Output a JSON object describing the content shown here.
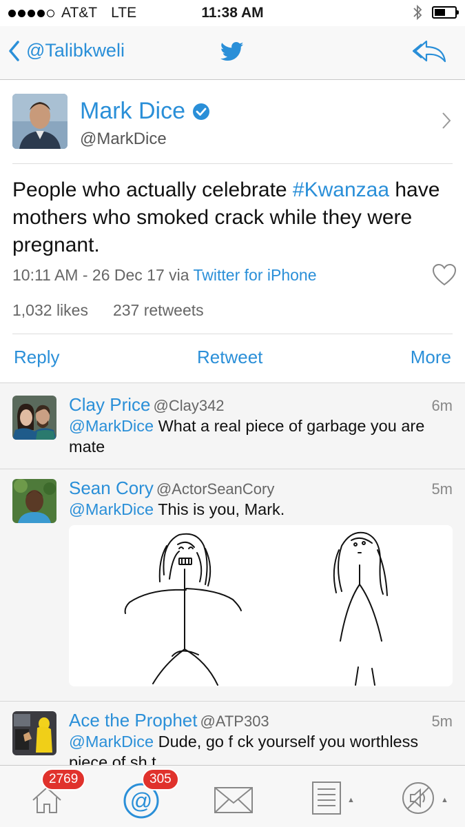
{
  "status_bar": {
    "carrier": "AT&T",
    "network": "LTE",
    "time": "11:38 AM",
    "signal_bars": 4,
    "battery_level": 0.55
  },
  "nav": {
    "back_label": "@Talibkweli",
    "center_icon": "twitter-bird-icon",
    "right_icon": "reply-all-icon"
  },
  "profile": {
    "name": "Mark Dice",
    "handle": "@MarkDice",
    "verified": true
  },
  "tweet": {
    "text_before": "People who actually celebrate ",
    "hashtag": "#Kwanzaa",
    "text_after": " have mothers who smoked crack while they were pregnant.",
    "timestamp": "10:11 AM - 26 Dec 17 via ",
    "client": "Twitter for iPhone",
    "likes": "1,032 likes",
    "retweets": "237 retweets"
  },
  "actions": {
    "reply": "Reply",
    "retweet": "Retweet",
    "more": "More"
  },
  "replies": [
    {
      "name": "Clay Price",
      "handle": "@Clay342",
      "time": "6m",
      "mention": "@MarkDice",
      "text": " What a real piece of garbage you are mate"
    },
    {
      "name": "Sean Cory",
      "handle": "@ActorSeanCory",
      "time": "5m",
      "mention": "@MarkDice",
      "text": " This is you, Mark."
    },
    {
      "name": "Ace the Prophet",
      "handle": "@ATP303",
      "time": "5m",
      "mention": "@MarkDice",
      "text": " Dude, go f  ck yourself you worthless piece of sh t"
    }
  ],
  "tabbar": {
    "home_badge": "2769",
    "mentions_badge": "305"
  },
  "colors": {
    "accent": "#2a8fd8",
    "badge": "#e0322c"
  }
}
